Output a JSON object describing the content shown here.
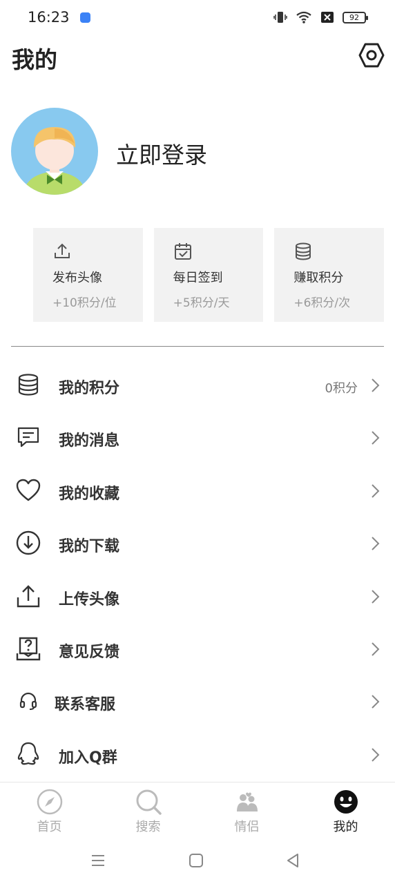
{
  "status_bar": {
    "time": "16:23",
    "battery": "92"
  },
  "header": {
    "title": "我的"
  },
  "profile": {
    "login_text": "立即登录"
  },
  "cards": [
    {
      "icon": "upload-icon",
      "title": "发布头像",
      "sub": "+10积分/位"
    },
    {
      "icon": "calendar-check-icon",
      "title": "每日签到",
      "sub": "+5积分/天"
    },
    {
      "icon": "coins-icon",
      "title": "赚取积分",
      "sub": "+6积分/次"
    }
  ],
  "menu": [
    {
      "icon": "database-icon",
      "label": "我的积分",
      "value": "0积分"
    },
    {
      "icon": "message-icon",
      "label": "我的消息"
    },
    {
      "icon": "heart-icon",
      "label": "我的收藏"
    },
    {
      "icon": "download-icon",
      "label": "我的下载"
    },
    {
      "icon": "upload-icon",
      "label": "上传头像"
    },
    {
      "icon": "feedback-icon",
      "label": "意见反馈"
    },
    {
      "icon": "headset-icon",
      "label": "联系客服"
    },
    {
      "icon": "qq-icon",
      "label": "加入Q群"
    }
  ],
  "bottom_nav": [
    {
      "icon": "compass-icon",
      "label": "首页"
    },
    {
      "icon": "search-icon",
      "label": "搜索"
    },
    {
      "icon": "couple-icon",
      "label": "情侣"
    },
    {
      "icon": "smiley-icon",
      "label": "我的",
      "active": true
    }
  ]
}
